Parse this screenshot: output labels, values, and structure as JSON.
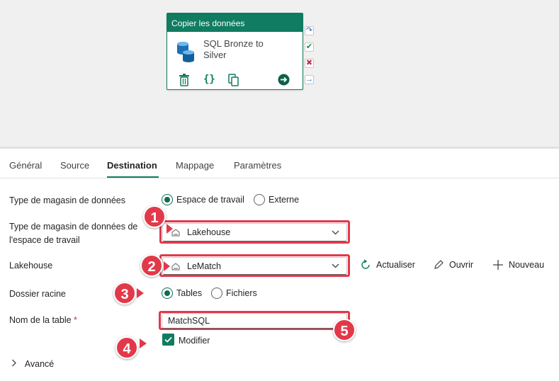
{
  "activity": {
    "type_label": "Copier les données",
    "name": "SQL Bronze to Silver"
  },
  "tabs": [
    {
      "label": "Général"
    },
    {
      "label": "Source"
    },
    {
      "label": "Destination",
      "active": true
    },
    {
      "label": "Mappage"
    },
    {
      "label": "Paramètres"
    }
  ],
  "form": {
    "store_type": {
      "label": "Type de magasin de données",
      "options": [
        "Espace de travail",
        "Externe"
      ],
      "selected": "Espace de travail"
    },
    "workspace_store_type": {
      "label": "Type de magasin de données de l'espace de travail",
      "value": "Lakehouse"
    },
    "lakehouse": {
      "label": "Lakehouse",
      "value": "LeMatch",
      "actions": [
        "Actualiser",
        "Ouvrir",
        "Nouveau"
      ]
    },
    "root_folder": {
      "label": "Dossier racine",
      "options": [
        "Tables",
        "Fichiers"
      ],
      "selected": "Tables"
    },
    "table_name": {
      "label": "Nom de la table",
      "required_mark": "*",
      "value": "MatchSQL",
      "edit_label": "Modifier",
      "edit_checked": true
    },
    "advanced_label": "Avancé"
  },
  "callouts": [
    "1",
    "2",
    "3",
    "4",
    "5"
  ],
  "colors": {
    "accent": "#107c61",
    "highlight": "#e2394a"
  }
}
